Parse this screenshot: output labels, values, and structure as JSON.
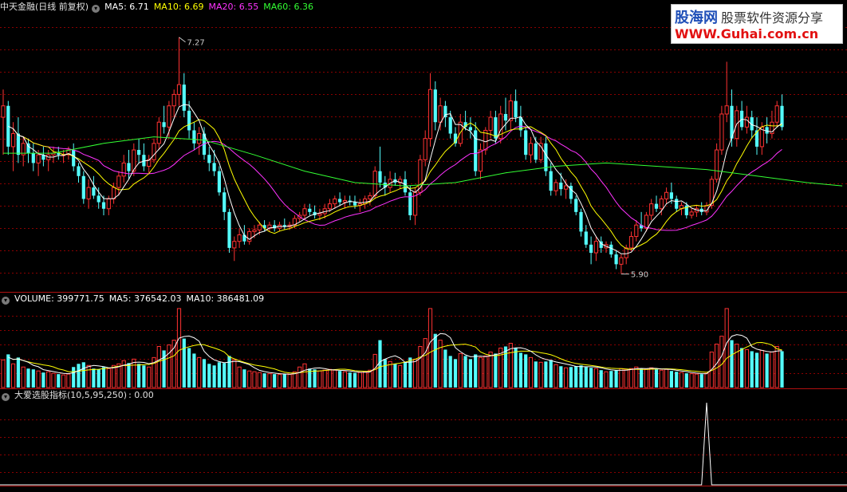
{
  "main_panel": {
    "stock_name": "中天金融(日线 前复权)",
    "ma_labels": [
      {
        "text": "MA5: 6.71",
        "color": "#ffffff"
      },
      {
        "text": "MA10: 6.69",
        "color": "#ffff00"
      },
      {
        "text": "MA20: 6.55",
        "color": "#ff33ff"
      },
      {
        "text": "MA60: 6.36",
        "color": "#33ff33"
      }
    ],
    "high_label": "7.27",
    "low_label": "5.90"
  },
  "volume_panel": {
    "labels": [
      {
        "text": "VOLUME: 399771.75",
        "color": "#ffffff"
      },
      {
        "text": "MA5: 376542.03",
        "color": "#ffffff"
      },
      {
        "text": "MA10: 386481.09",
        "color": "#ffffff"
      }
    ]
  },
  "indicator_panel": {
    "name": "大爱选股指标(10,5,95,250)",
    "value": ": 0.00"
  },
  "watermark": {
    "line1_brand": "股海网",
    "line1_slogan": "股票软件资源分享",
    "line2": "WWW.Guhai.com.cn"
  },
  "colors": {
    "up": "#ff3232",
    "down": "#54fcfc",
    "ma5": "#ffffff",
    "ma10": "#ffff00",
    "ma20": "#ff33ff",
    "ma60": "#33ff33",
    "grid": "#8b0000",
    "separator": "#b01010"
  },
  "chart_data": {
    "type": "candlestick",
    "price_range": [
      5.75,
      7.42
    ],
    "volume_range": [
      0,
      1050000
    ],
    "indicator_range": [
      0,
      1
    ],
    "candles": [
      {
        "o": 6.78,
        "h": 6.95,
        "l": 6.55,
        "c": 6.85,
        "v": 350000
      },
      {
        "o": 6.85,
        "h": 6.88,
        "l": 6.55,
        "c": 6.6,
        "v": 420000
      },
      {
        "o": 6.6,
        "h": 6.75,
        "l": 6.45,
        "c": 6.68,
        "v": 300000
      },
      {
        "o": 6.68,
        "h": 6.78,
        "l": 6.5,
        "c": 6.55,
        "v": 380000
      },
      {
        "o": 6.55,
        "h": 6.66,
        "l": 6.48,
        "c": 6.62,
        "v": 260000
      },
      {
        "o": 6.62,
        "h": 6.65,
        "l": 6.5,
        "c": 6.56,
        "v": 240000
      },
      {
        "o": 6.56,
        "h": 6.62,
        "l": 6.45,
        "c": 6.5,
        "v": 230000
      },
      {
        "o": 6.5,
        "h": 6.58,
        "l": 6.42,
        "c": 6.55,
        "v": 210000
      },
      {
        "o": 6.55,
        "h": 6.6,
        "l": 6.48,
        "c": 6.52,
        "v": 190000
      },
      {
        "o": 6.52,
        "h": 6.58,
        "l": 6.45,
        "c": 6.55,
        "v": 200000
      },
      {
        "o": 6.55,
        "h": 6.6,
        "l": 6.5,
        "c": 6.56,
        "v": 180000
      },
      {
        "o": 6.56,
        "h": 6.6,
        "l": 6.52,
        "c": 6.55,
        "v": 170000
      },
      {
        "o": 6.55,
        "h": 6.58,
        "l": 6.5,
        "c": 6.55,
        "v": 160000
      },
      {
        "o": 6.55,
        "h": 6.6,
        "l": 6.52,
        "c": 6.58,
        "v": 170000
      },
      {
        "o": 6.58,
        "h": 6.62,
        "l": 6.45,
        "c": 6.48,
        "v": 260000
      },
      {
        "o": 6.48,
        "h": 6.5,
        "l": 6.38,
        "c": 6.42,
        "v": 300000
      },
      {
        "o": 6.42,
        "h": 6.45,
        "l": 6.25,
        "c": 6.28,
        "v": 320000
      },
      {
        "o": 6.28,
        "h": 6.4,
        "l": 6.22,
        "c": 6.35,
        "v": 280000
      },
      {
        "o": 6.35,
        "h": 6.42,
        "l": 6.28,
        "c": 6.3,
        "v": 240000
      },
      {
        "o": 6.3,
        "h": 6.35,
        "l": 6.22,
        "c": 6.26,
        "v": 230000
      },
      {
        "o": 6.26,
        "h": 6.3,
        "l": 6.18,
        "c": 6.22,
        "v": 260000
      },
      {
        "o": 6.22,
        "h": 6.3,
        "l": 6.18,
        "c": 6.28,
        "v": 240000
      },
      {
        "o": 6.28,
        "h": 6.38,
        "l": 6.25,
        "c": 6.35,
        "v": 280000
      },
      {
        "o": 6.35,
        "h": 6.45,
        "l": 6.3,
        "c": 6.42,
        "v": 300000
      },
      {
        "o": 6.42,
        "h": 6.55,
        "l": 6.38,
        "c": 6.5,
        "v": 340000
      },
      {
        "o": 6.5,
        "h": 6.58,
        "l": 6.4,
        "c": 6.45,
        "v": 310000
      },
      {
        "o": 6.45,
        "h": 6.62,
        "l": 6.42,
        "c": 6.58,
        "v": 360000
      },
      {
        "o": 6.58,
        "h": 6.65,
        "l": 6.5,
        "c": 6.55,
        "v": 300000
      },
      {
        "o": 6.55,
        "h": 6.62,
        "l": 6.45,
        "c": 6.48,
        "v": 280000
      },
      {
        "o": 6.48,
        "h": 6.55,
        "l": 6.44,
        "c": 6.52,
        "v": 260000
      },
      {
        "o": 6.52,
        "h": 6.65,
        "l": 6.5,
        "c": 6.62,
        "v": 380000
      },
      {
        "o": 6.62,
        "h": 6.78,
        "l": 6.58,
        "c": 6.75,
        "v": 520000
      },
      {
        "o": 6.75,
        "h": 6.85,
        "l": 6.68,
        "c": 6.72,
        "v": 470000
      },
      {
        "o": 6.72,
        "h": 6.88,
        "l": 6.65,
        "c": 6.85,
        "v": 540000
      },
      {
        "o": 6.85,
        "h": 6.95,
        "l": 6.78,
        "c": 6.92,
        "v": 600000
      },
      {
        "o": 6.92,
        "h": 7.27,
        "l": 6.85,
        "c": 6.98,
        "v": 1000000
      },
      {
        "o": 6.98,
        "h": 7.05,
        "l": 6.78,
        "c": 6.82,
        "v": 620000
      },
      {
        "o": 6.82,
        "h": 6.88,
        "l": 6.65,
        "c": 6.7,
        "v": 500000
      },
      {
        "o": 6.7,
        "h": 6.75,
        "l": 6.58,
        "c": 6.62,
        "v": 430000
      },
      {
        "o": 6.62,
        "h": 6.72,
        "l": 6.55,
        "c": 6.68,
        "v": 380000
      },
      {
        "o": 6.68,
        "h": 6.72,
        "l": 6.52,
        "c": 6.55,
        "v": 360000
      },
      {
        "o": 6.55,
        "h": 6.6,
        "l": 6.45,
        "c": 6.5,
        "v": 300000
      },
      {
        "o": 6.5,
        "h": 6.58,
        "l": 6.42,
        "c": 6.45,
        "v": 280000
      },
      {
        "o": 6.45,
        "h": 6.48,
        "l": 6.3,
        "c": 6.32,
        "v": 320000
      },
      {
        "o": 6.32,
        "h": 6.35,
        "l": 6.15,
        "c": 6.2,
        "v": 310000
      },
      {
        "o": 6.2,
        "h": 6.22,
        "l": 5.95,
        "c": 5.98,
        "v": 400000
      },
      {
        "o": 5.98,
        "h": 6.05,
        "l": 5.9,
        "c": 6.02,
        "v": 350000
      },
      {
        "o": 6.02,
        "h": 6.1,
        "l": 5.98,
        "c": 6.06,
        "v": 260000
      },
      {
        "o": 6.06,
        "h": 6.12,
        "l": 6.0,
        "c": 6.02,
        "v": 230000
      },
      {
        "o": 6.02,
        "h": 6.1,
        "l": 6.0,
        "c": 6.08,
        "v": 210000
      },
      {
        "o": 6.08,
        "h": 6.12,
        "l": 6.04,
        "c": 6.09,
        "v": 200000
      },
      {
        "o": 6.09,
        "h": 6.14,
        "l": 6.06,
        "c": 6.12,
        "v": 190000
      },
      {
        "o": 6.12,
        "h": 6.15,
        "l": 6.08,
        "c": 6.1,
        "v": 180000
      },
      {
        "o": 6.1,
        "h": 6.14,
        "l": 6.08,
        "c": 6.12,
        "v": 175000
      },
      {
        "o": 6.12,
        "h": 6.15,
        "l": 6.08,
        "c": 6.1,
        "v": 170000
      },
      {
        "o": 6.1,
        "h": 6.14,
        "l": 6.08,
        "c": 6.12,
        "v": 165000
      },
      {
        "o": 6.12,
        "h": 6.16,
        "l": 6.09,
        "c": 6.11,
        "v": 170000
      },
      {
        "o": 6.11,
        "h": 6.14,
        "l": 6.09,
        "c": 6.12,
        "v": 165000
      },
      {
        "o": 6.12,
        "h": 6.18,
        "l": 6.1,
        "c": 6.16,
        "v": 200000
      },
      {
        "o": 6.16,
        "h": 6.2,
        "l": 6.14,
        "c": 6.18,
        "v": 260000
      },
      {
        "o": 6.18,
        "h": 6.25,
        "l": 6.15,
        "c": 6.22,
        "v": 300000
      },
      {
        "o": 6.22,
        "h": 6.25,
        "l": 6.18,
        "c": 6.2,
        "v": 240000
      },
      {
        "o": 6.2,
        "h": 6.24,
        "l": 6.16,
        "c": 6.18,
        "v": 230000
      },
      {
        "o": 6.18,
        "h": 6.22,
        "l": 6.15,
        "c": 6.19,
        "v": 210000
      },
      {
        "o": 6.19,
        "h": 6.25,
        "l": 6.16,
        "c": 6.22,
        "v": 220000
      },
      {
        "o": 6.22,
        "h": 6.28,
        "l": 6.2,
        "c": 6.25,
        "v": 230000
      },
      {
        "o": 6.25,
        "h": 6.3,
        "l": 6.22,
        "c": 6.28,
        "v": 220000
      },
      {
        "o": 6.28,
        "h": 6.32,
        "l": 6.24,
        "c": 6.26,
        "v": 210000
      },
      {
        "o": 6.26,
        "h": 6.3,
        "l": 6.22,
        "c": 6.27,
        "v": 200000
      },
      {
        "o": 6.27,
        "h": 6.3,
        "l": 6.24,
        "c": 6.26,
        "v": 190000
      },
      {
        "o": 6.26,
        "h": 6.3,
        "l": 6.22,
        "c": 6.24,
        "v": 185000
      },
      {
        "o": 6.24,
        "h": 6.28,
        "l": 6.2,
        "c": 6.25,
        "v": 190000
      },
      {
        "o": 6.25,
        "h": 6.3,
        "l": 6.22,
        "c": 6.28,
        "v": 200000
      },
      {
        "o": 6.28,
        "h": 6.32,
        "l": 6.24,
        "c": 6.3,
        "v": 220000
      },
      {
        "o": 6.3,
        "h": 6.48,
        "l": 6.28,
        "c": 6.45,
        "v": 420000
      },
      {
        "o": 6.45,
        "h": 6.6,
        "l": 6.35,
        "c": 6.38,
        "v": 600000
      },
      {
        "o": 6.38,
        "h": 6.42,
        "l": 6.3,
        "c": 6.35,
        "v": 360000
      },
      {
        "o": 6.35,
        "h": 6.45,
        "l": 6.32,
        "c": 6.4,
        "v": 330000
      },
      {
        "o": 6.4,
        "h": 6.44,
        "l": 6.36,
        "c": 6.38,
        "v": 300000
      },
      {
        "o": 6.38,
        "h": 6.42,
        "l": 6.34,
        "c": 6.4,
        "v": 280000
      },
      {
        "o": 6.4,
        "h": 6.45,
        "l": 6.3,
        "c": 6.32,
        "v": 320000
      },
      {
        "o": 6.32,
        "h": 6.36,
        "l": 6.15,
        "c": 6.18,
        "v": 380000
      },
      {
        "o": 6.18,
        "h": 6.35,
        "l": 6.12,
        "c": 6.32,
        "v": 360000
      },
      {
        "o": 6.32,
        "h": 6.55,
        "l": 6.3,
        "c": 6.52,
        "v": 520000
      },
      {
        "o": 6.52,
        "h": 6.7,
        "l": 6.48,
        "c": 6.65,
        "v": 620000
      },
      {
        "o": 6.65,
        "h": 7.05,
        "l": 6.6,
        "c": 6.95,
        "v": 1000000
      },
      {
        "o": 6.95,
        "h": 7.0,
        "l": 6.7,
        "c": 6.75,
        "v": 680000
      },
      {
        "o": 6.75,
        "h": 6.9,
        "l": 6.7,
        "c": 6.85,
        "v": 600000
      },
      {
        "o": 6.85,
        "h": 6.88,
        "l": 6.72,
        "c": 6.78,
        "v": 480000
      },
      {
        "o": 6.78,
        "h": 6.82,
        "l": 6.65,
        "c": 6.68,
        "v": 400000
      },
      {
        "o": 6.68,
        "h": 6.72,
        "l": 6.6,
        "c": 6.62,
        "v": 360000
      },
      {
        "o": 6.62,
        "h": 6.8,
        "l": 6.6,
        "c": 6.75,
        "v": 430000
      },
      {
        "o": 6.75,
        "h": 6.82,
        "l": 6.7,
        "c": 6.72,
        "v": 400000
      },
      {
        "o": 6.72,
        "h": 6.78,
        "l": 6.65,
        "c": 6.7,
        "v": 360000
      },
      {
        "o": 6.7,
        "h": 6.75,
        "l": 6.42,
        "c": 6.45,
        "v": 420000
      },
      {
        "o": 6.45,
        "h": 6.62,
        "l": 6.4,
        "c": 6.58,
        "v": 380000
      },
      {
        "o": 6.58,
        "h": 6.72,
        "l": 6.55,
        "c": 6.7,
        "v": 400000
      },
      {
        "o": 6.7,
        "h": 6.82,
        "l": 6.65,
        "c": 6.78,
        "v": 450000
      },
      {
        "o": 6.78,
        "h": 6.82,
        "l": 6.62,
        "c": 6.65,
        "v": 430000
      },
      {
        "o": 6.65,
        "h": 6.85,
        "l": 6.62,
        "c": 6.8,
        "v": 500000
      },
      {
        "o": 6.8,
        "h": 6.9,
        "l": 6.7,
        "c": 6.76,
        "v": 520000
      },
      {
        "o": 6.76,
        "h": 6.92,
        "l": 6.7,
        "c": 6.88,
        "v": 560000
      },
      {
        "o": 6.88,
        "h": 6.95,
        "l": 6.75,
        "c": 6.78,
        "v": 500000
      },
      {
        "o": 6.78,
        "h": 6.85,
        "l": 6.66,
        "c": 6.7,
        "v": 440000
      },
      {
        "o": 6.7,
        "h": 6.72,
        "l": 6.52,
        "c": 6.55,
        "v": 420000
      },
      {
        "o": 6.55,
        "h": 6.66,
        "l": 6.5,
        "c": 6.62,
        "v": 380000
      },
      {
        "o": 6.62,
        "h": 6.66,
        "l": 6.5,
        "c": 6.52,
        "v": 330000
      },
      {
        "o": 6.52,
        "h": 6.66,
        "l": 6.5,
        "c": 6.62,
        "v": 320000
      },
      {
        "o": 6.62,
        "h": 6.66,
        "l": 6.42,
        "c": 6.45,
        "v": 330000
      },
      {
        "o": 6.45,
        "h": 6.5,
        "l": 6.3,
        "c": 6.33,
        "v": 350000
      },
      {
        "o": 6.33,
        "h": 6.4,
        "l": 6.3,
        "c": 6.38,
        "v": 290000
      },
      {
        "o": 6.38,
        "h": 6.44,
        "l": 6.3,
        "c": 6.34,
        "v": 270000
      },
      {
        "o": 6.34,
        "h": 6.4,
        "l": 6.28,
        "c": 6.36,
        "v": 250000
      },
      {
        "o": 6.36,
        "h": 6.38,
        "l": 6.25,
        "c": 6.28,
        "v": 260000
      },
      {
        "o": 6.28,
        "h": 6.3,
        "l": 6.18,
        "c": 6.2,
        "v": 270000
      },
      {
        "o": 6.2,
        "h": 6.22,
        "l": 6.05,
        "c": 6.08,
        "v": 280000
      },
      {
        "o": 6.08,
        "h": 6.12,
        "l": 5.98,
        "c": 6.0,
        "v": 260000
      },
      {
        "o": 6.0,
        "h": 6.05,
        "l": 5.88,
        "c": 5.95,
        "v": 250000
      },
      {
        "o": 5.95,
        "h": 6.05,
        "l": 5.9,
        "c": 6.02,
        "v": 240000
      },
      {
        "o": 6.02,
        "h": 6.05,
        "l": 5.95,
        "c": 5.98,
        "v": 220000
      },
      {
        "o": 5.98,
        "h": 6.02,
        "l": 5.95,
        "c": 6.0,
        "v": 200000
      },
      {
        "o": 6.0,
        "h": 6.02,
        "l": 5.92,
        "c": 5.94,
        "v": 210000
      },
      {
        "o": 5.94,
        "h": 5.96,
        "l": 5.85,
        "c": 5.88,
        "v": 220000
      },
      {
        "o": 5.88,
        "h": 5.94,
        "l": 5.82,
        "c": 5.92,
        "v": 240000
      },
      {
        "o": 5.92,
        "h": 6.0,
        "l": 5.88,
        "c": 5.98,
        "v": 230000
      },
      {
        "o": 5.98,
        "h": 6.08,
        "l": 5.96,
        "c": 6.05,
        "v": 240000
      },
      {
        "o": 6.05,
        "h": 6.15,
        "l": 6.02,
        "c": 6.12,
        "v": 260000
      },
      {
        "o": 6.12,
        "h": 6.2,
        "l": 6.08,
        "c": 6.1,
        "v": 240000
      },
      {
        "o": 6.1,
        "h": 6.2,
        "l": 6.08,
        "c": 6.18,
        "v": 230000
      },
      {
        "o": 6.18,
        "h": 6.28,
        "l": 6.15,
        "c": 6.25,
        "v": 250000
      },
      {
        "o": 6.25,
        "h": 6.3,
        "l": 6.2,
        "c": 6.22,
        "v": 230000
      },
      {
        "o": 6.22,
        "h": 6.3,
        "l": 6.18,
        "c": 6.28,
        "v": 220000
      },
      {
        "o": 6.28,
        "h": 6.35,
        "l": 6.25,
        "c": 6.32,
        "v": 230000
      },
      {
        "o": 6.32,
        "h": 6.38,
        "l": 6.25,
        "c": 6.28,
        "v": 210000
      },
      {
        "o": 6.28,
        "h": 6.3,
        "l": 6.2,
        "c": 6.22,
        "v": 200000
      },
      {
        "o": 6.22,
        "h": 6.26,
        "l": 6.18,
        "c": 6.24,
        "v": 190000
      },
      {
        "o": 6.24,
        "h": 6.26,
        "l": 6.16,
        "c": 6.18,
        "v": 180000
      },
      {
        "o": 6.18,
        "h": 6.22,
        "l": 6.16,
        "c": 6.2,
        "v": 175000
      },
      {
        "o": 6.2,
        "h": 6.24,
        "l": 6.17,
        "c": 6.22,
        "v": 170000
      },
      {
        "o": 6.22,
        "h": 6.26,
        "l": 6.18,
        "c": 6.2,
        "v": 170000
      },
      {
        "o": 6.2,
        "h": 6.26,
        "l": 6.18,
        "c": 6.24,
        "v": 180000
      },
      {
        "o": 6.24,
        "h": 6.42,
        "l": 6.22,
        "c": 6.4,
        "v": 450000
      },
      {
        "o": 6.4,
        "h": 6.62,
        "l": 6.38,
        "c": 6.58,
        "v": 550000
      },
      {
        "o": 6.58,
        "h": 6.85,
        "l": 6.55,
        "c": 6.8,
        "v": 650000
      },
      {
        "o": 6.8,
        "h": 7.12,
        "l": 6.75,
        "c": 6.85,
        "v": 1000000
      },
      {
        "o": 6.85,
        "h": 6.95,
        "l": 6.6,
        "c": 6.65,
        "v": 600000
      },
      {
        "o": 6.65,
        "h": 6.85,
        "l": 6.6,
        "c": 6.82,
        "v": 550000
      },
      {
        "o": 6.82,
        "h": 6.88,
        "l": 6.7,
        "c": 6.72,
        "v": 500000
      },
      {
        "o": 6.72,
        "h": 6.85,
        "l": 6.68,
        "c": 6.78,
        "v": 480000
      },
      {
        "o": 6.78,
        "h": 6.82,
        "l": 6.65,
        "c": 6.7,
        "v": 460000
      },
      {
        "o": 6.7,
        "h": 6.78,
        "l": 6.55,
        "c": 6.6,
        "v": 440000
      },
      {
        "o": 6.6,
        "h": 6.75,
        "l": 6.55,
        "c": 6.72,
        "v": 470000
      },
      {
        "o": 6.72,
        "h": 6.78,
        "l": 6.62,
        "c": 6.68,
        "v": 430000
      },
      {
        "o": 6.68,
        "h": 6.82,
        "l": 6.65,
        "c": 6.75,
        "v": 450000
      },
      {
        "o": 6.75,
        "h": 6.88,
        "l": 6.72,
        "c": 6.85,
        "v": 520000
      },
      {
        "o": 6.85,
        "h": 6.92,
        "l": 6.7,
        "c": 6.72,
        "v": 460000
      }
    ],
    "ma60_points": [
      [
        0,
        6.56
      ],
      [
        10,
        6.56
      ],
      [
        20,
        6.62
      ],
      [
        30,
        6.66
      ],
      [
        40,
        6.64
      ],
      [
        50,
        6.55
      ],
      [
        60,
        6.45
      ],
      [
        70,
        6.38
      ],
      [
        80,
        6.36
      ],
      [
        90,
        6.38
      ],
      [
        100,
        6.44
      ],
      [
        110,
        6.48
      ],
      [
        120,
        6.5
      ],
      [
        130,
        6.48
      ],
      [
        140,
        6.46
      ],
      [
        150,
        6.42
      ],
      [
        160,
        6.38
      ],
      [
        167,
        6.36
      ]
    ],
    "signal": {
      "peak_index": 140,
      "peak_value": 1,
      "final_value": 0.0
    }
  }
}
